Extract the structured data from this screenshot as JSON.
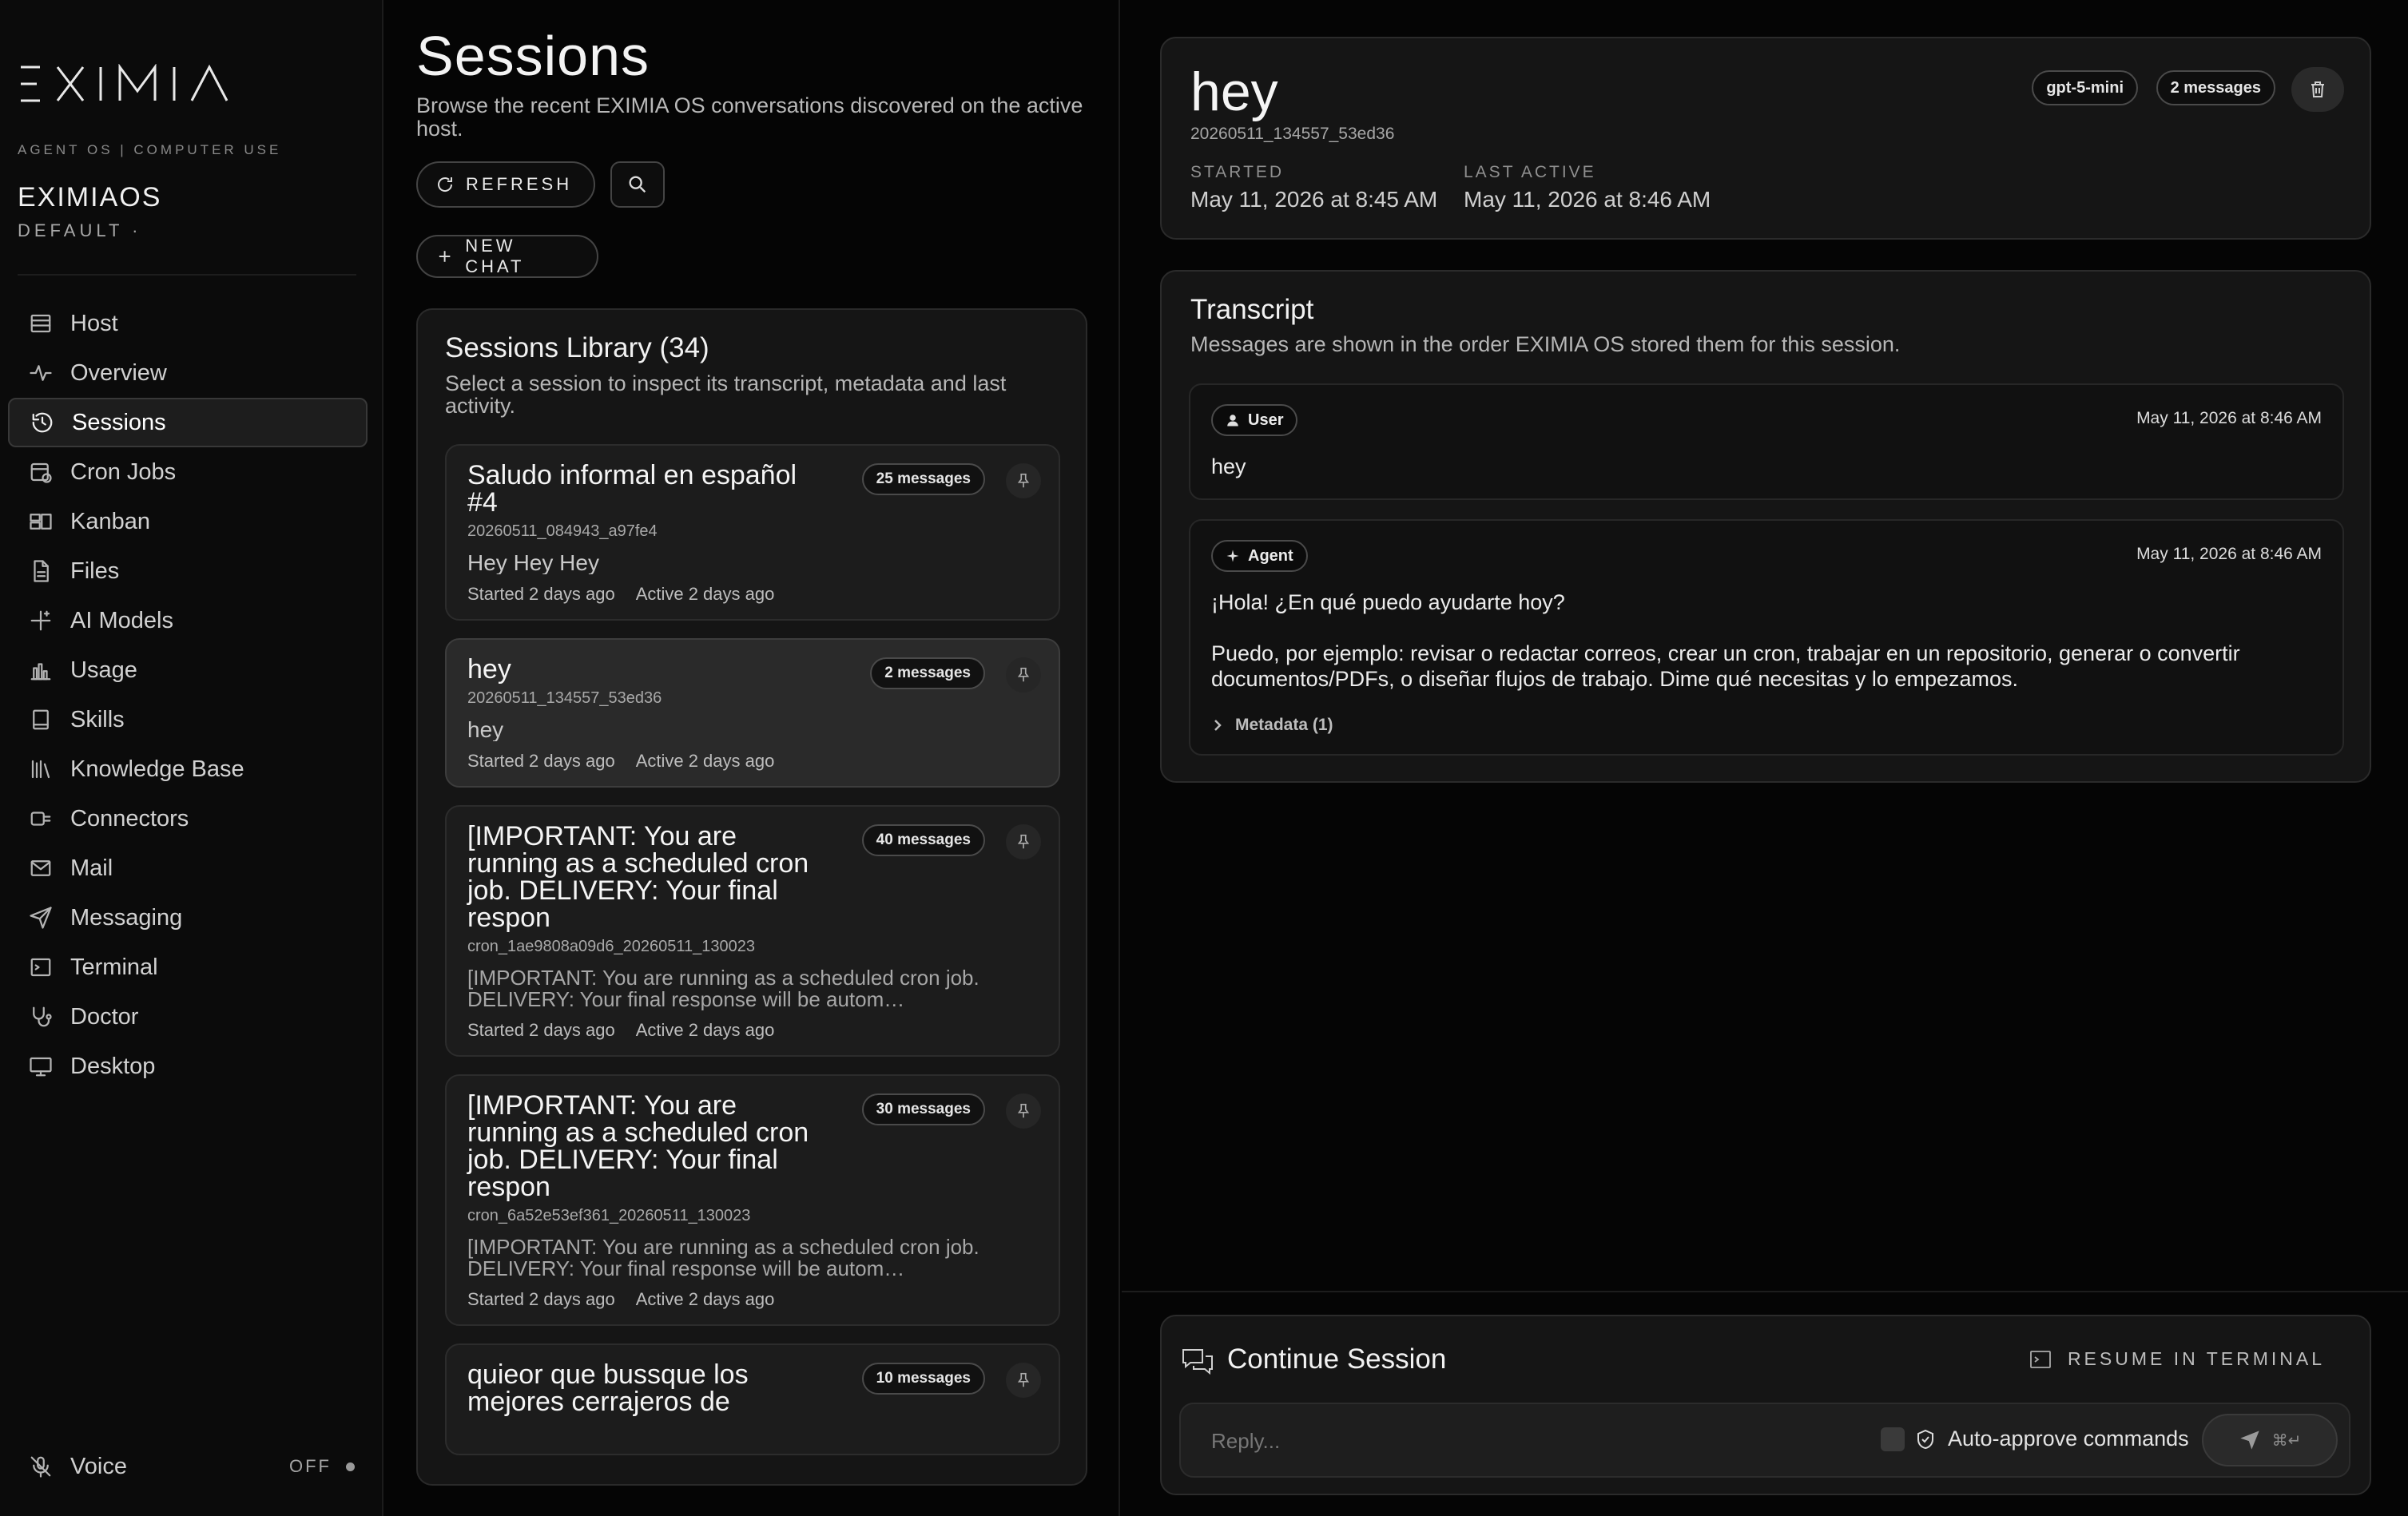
{
  "sidebar": {
    "brand": "EXIMIA",
    "tagline": "AGENT OS | COMPUTER USE",
    "workspace": "EXIMIAOS",
    "profile": "DEFAULT ·",
    "items": [
      {
        "label": "Host",
        "icon": "server-icon"
      },
      {
        "label": "Overview",
        "icon": "pulse-icon"
      },
      {
        "label": "Sessions",
        "icon": "history-icon",
        "active": true
      },
      {
        "label": "Cron Jobs",
        "icon": "calendar-clock-icon"
      },
      {
        "label": "Kanban",
        "icon": "kanban-icon"
      },
      {
        "label": "Files",
        "icon": "file-icon"
      },
      {
        "label": "AI Models",
        "icon": "sparkles-icon"
      },
      {
        "label": "Usage",
        "icon": "bar-chart-icon"
      },
      {
        "label": "Skills",
        "icon": "book-icon"
      },
      {
        "label": "Knowledge Base",
        "icon": "library-icon"
      },
      {
        "label": "Connectors",
        "icon": "plug-icon"
      },
      {
        "label": "Mail",
        "icon": "mail-icon"
      },
      {
        "label": "Messaging",
        "icon": "send-icon"
      },
      {
        "label": "Terminal",
        "icon": "terminal-icon"
      },
      {
        "label": "Doctor",
        "icon": "stethoscope-icon"
      },
      {
        "label": "Desktop",
        "icon": "monitor-icon"
      }
    ],
    "voice": {
      "label": "Voice",
      "state": "OFF"
    }
  },
  "sessions": {
    "title": "Sessions",
    "subtitle": "Browse the recent EXIMIA OS conversations discovered on the active host.",
    "refresh_label": "REFRESH",
    "new_chat_label": "NEW CHAT",
    "library_title": "Sessions Library (34)",
    "library_subtitle": "Select a session to inspect its transcript, metadata and last activity.",
    "cards": [
      {
        "title": "Saludo informal en español #4",
        "id": "20260511_084943_a97fe4",
        "badge": "25 messages",
        "preview": "Hey  Hey  Hey",
        "started": "Started 2 days ago",
        "active": "Active 2 days ago"
      },
      {
        "title": "hey",
        "id": "20260511_134557_53ed36",
        "badge": "2 messages",
        "preview": "hey",
        "started": "Started 2 days ago",
        "active": "Active 2 days ago",
        "selected": true
      },
      {
        "title": "[IMPORTANT: You are running as a scheduled cron job. DELIVERY: Your final respon",
        "id": "cron_1ae9808a09d6_20260511_130023",
        "badge": "40 messages",
        "preview": "[IMPORTANT: You are running as a scheduled cron job. DELIVERY: Your final response will be autom…",
        "started": "Started 2 days ago",
        "active": "Active 2 days ago"
      },
      {
        "title": "[IMPORTANT: You are running as a scheduled cron job. DELIVERY: Your final respon",
        "id": "cron_6a52e53ef361_20260511_130023",
        "badge": "30 messages",
        "preview": "[IMPORTANT: You are running as a scheduled cron job. DELIVERY: Your final response will be autom…",
        "started": "Started 2 days ago",
        "active": "Active 2 days ago"
      },
      {
        "title": "quieor que bussque los mejores cerrajeros de",
        "badge": "10 messages"
      }
    ]
  },
  "detail": {
    "title": "hey",
    "id": "20260511_134557_53ed36",
    "model": "gpt-5-mini",
    "messages": "2 messages",
    "started_label": "STARTED",
    "started": "May 11, 2026 at 8:45 AM",
    "last_active_label": "LAST ACTIVE",
    "last_active": "May 11, 2026 at 8:46 AM"
  },
  "transcript": {
    "title": "Transcript",
    "subtitle": "Messages are shown in the order EXIMIA OS stored them for this session.",
    "messages": [
      {
        "role": "User",
        "time": "May 11, 2026 at 8:46 AM",
        "text": "hey"
      },
      {
        "role": "Agent",
        "time": "May 11, 2026 at 8:46 AM",
        "text_1": "¡Hola! ¿En qué puedo ayudarte hoy?",
        "text_2": "Puedo, por ejemplo: revisar o redactar correos, crear un cron, trabajar en un repositorio, generar o convertir documentos/PDFs, o diseñar flujos de trabajo. Dime qué necesitas y lo empezamos.",
        "metadata": "Metadata  (1)"
      }
    ]
  },
  "continue": {
    "title": "Continue Session",
    "resume_label": "RESUME IN TERMINAL",
    "placeholder": "Reply...",
    "auto_approve": "Auto-approve commands",
    "shortcut": "⌘↵"
  }
}
